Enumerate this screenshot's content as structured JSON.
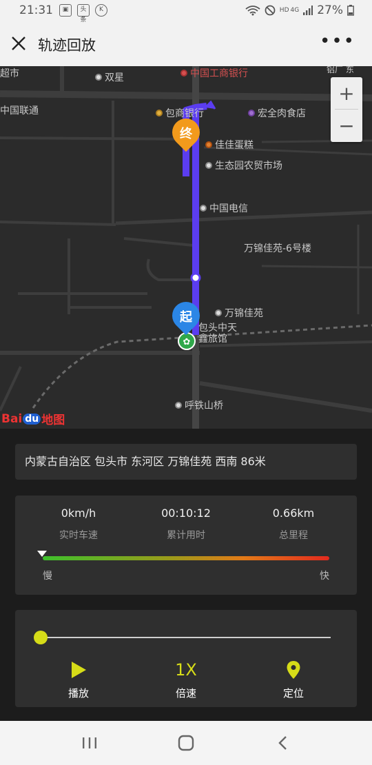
{
  "status_bar": {
    "time": "21:31",
    "left_icons": [
      "image-icon",
      "toutiao-icon",
      "k-icon"
    ],
    "toutiao_label": "头条",
    "k_label": "K",
    "hd_label": "HD",
    "net_label": "4G",
    "battery": "27%"
  },
  "header": {
    "title": "轨迹回放"
  },
  "map": {
    "pois": {
      "chaoshi": "超市",
      "shuangxing": "双星",
      "icbc": "中国工商银行",
      "top_right": "铝厂 东",
      "unicom": "中国联通",
      "bank": "包商银行",
      "meat": "宏全肉食店",
      "cake": "佳佳蛋糕",
      "market": "生态园农贸市场",
      "telecom": "中国电信",
      "building6": "万锦佳苑-6号楼",
      "wanjin": "万锦佳苑",
      "hotel_line1": "包头中天",
      "hotel_line2": "鑫旅馆",
      "bridge": "呼铁山桥"
    },
    "start_label": "起",
    "end_label": "终",
    "zoom_in": "+",
    "zoom_out": "−",
    "logo": {
      "bai": "Bai",
      "du": "du",
      "map": "地图"
    }
  },
  "address": "内蒙古自治区 包头市 东河区 万锦佳苑 西南 86米",
  "stats": {
    "speed": {
      "value": "0km/h",
      "label": "实时车速"
    },
    "time": {
      "value": "00:10:12",
      "label": "累计用时"
    },
    "distance": {
      "value": "0.66km",
      "label": "总里程"
    }
  },
  "speed_legend": {
    "slow": "慢",
    "fast": "快"
  },
  "player": {
    "progress": 0,
    "play_label": "播放",
    "speed_value": "1X",
    "speed_label": "倍速",
    "locate_label": "定位"
  },
  "colors": {
    "accent": "#d6dc18",
    "track": "#5b3df0",
    "start_pin": "#2b86e6",
    "end_pin": "#f29a1c"
  }
}
